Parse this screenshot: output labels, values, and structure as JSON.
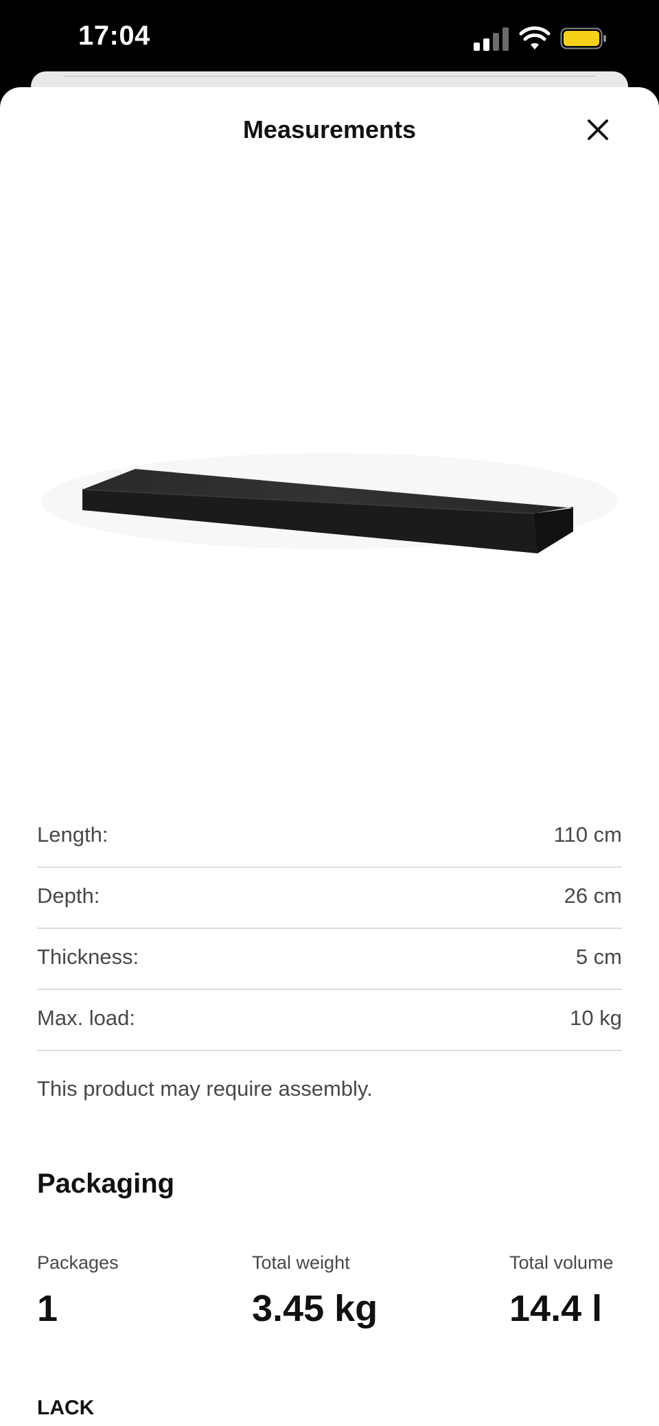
{
  "status_bar": {
    "time": "17:04",
    "battery_color": "#f7d117"
  },
  "header": {
    "title": "Measurements",
    "close_icon": "close-icon"
  },
  "product_image": {
    "description_icon": "shelf-image"
  },
  "measurements": [
    {
      "label": "Length:",
      "value": "110 cm"
    },
    {
      "label": "Depth:",
      "value": "26 cm"
    },
    {
      "label": "Thickness:",
      "value": "5 cm"
    },
    {
      "label": "Max. load:",
      "value": "10 kg"
    }
  ],
  "assembly_note": "This product may require assembly.",
  "packaging": {
    "heading": "Packaging",
    "packages_label": "Packages",
    "packages_value": "1",
    "weight_label": "Total weight",
    "weight_value": "3.45 kg",
    "volume_label": "Total volume",
    "volume_value": "14.4 l"
  },
  "product_name": "LACK"
}
